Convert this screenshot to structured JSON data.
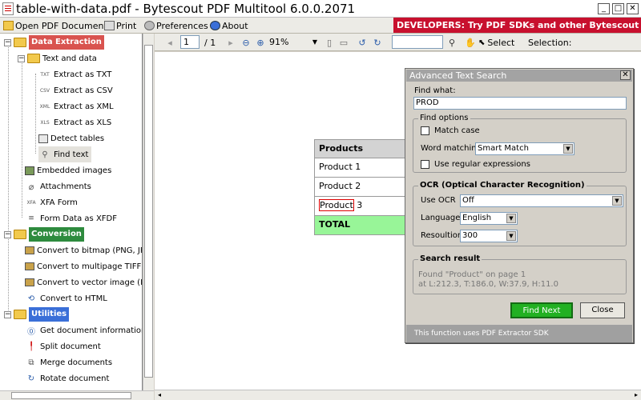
{
  "window": {
    "title": "table-with-data.pdf - Bytescout PDF Multitool 6.0.0.2071",
    "min": "_",
    "max": "□",
    "close": "✕"
  },
  "menu": {
    "open": "Open PDF Document",
    "print": "Print",
    "preferences": "Preferences",
    "about": "About"
  },
  "banner": "DEVELOPERS: Try PDF SDKs and other Bytescout produc",
  "tree": {
    "data_extraction": "Data Extraction",
    "text_and_data": "Text and data",
    "extract_txt": "Extract as TXT",
    "extract_csv": "Extract as CSV",
    "extract_xml": "Extract as XML",
    "extract_xls": "Extract as XLS",
    "detect_tables": "Detect tables",
    "find_text": "Find text",
    "embedded_images": "Embedded images",
    "attachments": "Attachments",
    "xfa_form": "XFA Form",
    "form_data": "Form Data as XFDF",
    "conversion": "Conversion",
    "convert_bitmap": "Convert to bitmap (PNG, JPEG,",
    "convert_tiff": "Convert to multipage TIFF",
    "convert_emf": "Convert to vector image (EMF)",
    "convert_html": "Convert to HTML",
    "utilities": "Utilities",
    "get_info": "Get document information",
    "split": "Split document",
    "merge": "Merge documents",
    "rotate": "Rotate document",
    "icons": {
      "txt": "TXT",
      "csv": "CSV",
      "xml": "XML",
      "xls": "XLS",
      "xfa": "XFA"
    }
  },
  "doctoolbar": {
    "page": "1",
    "pages": "/ 1",
    "zoom": "91%",
    "search": "",
    "select": "Select",
    "selection": "Selection:"
  },
  "table": {
    "header": "Products",
    "rows": [
      "Product 1",
      "Product 2"
    ],
    "row3_hl": "Product",
    "row3_rest": " 3",
    "total": "TOTAL"
  },
  "dialog": {
    "title": "Advanced Text Search",
    "find_what_label": "Find what:",
    "find_what_value": "PROD",
    "find_options": "Find options",
    "match_case": "Match case",
    "word_matching": "Word matching",
    "word_matching_value": "Smart Match",
    "use_regex": "Use regular expressions",
    "ocr_group": "OCR (Optical Character Recognition)",
    "use_ocr": "Use OCR",
    "use_ocr_value": "Off",
    "language": "Language",
    "language_value": "English",
    "resolution": "Resoultion",
    "resolution_value": "300",
    "search_result": "Search result",
    "result_line1": "Found \"Product\" on page 1",
    "result_line2": "at L:212.3, T:186.0, W:37.9, H:11.0",
    "find_next": "Find Next",
    "close": "Close",
    "footer": "This function uses PDF Extractor SDK"
  },
  "colors": {
    "data_extraction": "#d9534f",
    "conversion": "#2e8b3e",
    "utilities": "#3a6fd8",
    "banner": "#c8102e",
    "total_row": "#98f598",
    "find_next": "#22b022"
  }
}
